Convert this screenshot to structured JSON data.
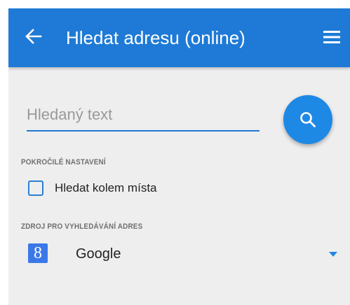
{
  "colors": {
    "appbar": "#1e7ad6",
    "accent": "#1e88e5",
    "background": "#eeeeee"
  },
  "appbar": {
    "title": "Hledat adresu (online)",
    "back_icon": "arrow-left-icon",
    "menu_icon": "hamburger-menu-icon"
  },
  "search": {
    "placeholder": "Hledaný text",
    "value": "",
    "button_icon": "search-icon"
  },
  "advanced": {
    "section_label": "POKROČILÉ NASTAVENÍ",
    "checkbox_label": "Hledat kolem místa",
    "checked": false
  },
  "source": {
    "section_label": "ZDROJ PRO VYHLEDÁVÁNÍ ADRES",
    "icon_glyph": "8",
    "icon_name": "google-logo-icon",
    "selected": "Google"
  }
}
